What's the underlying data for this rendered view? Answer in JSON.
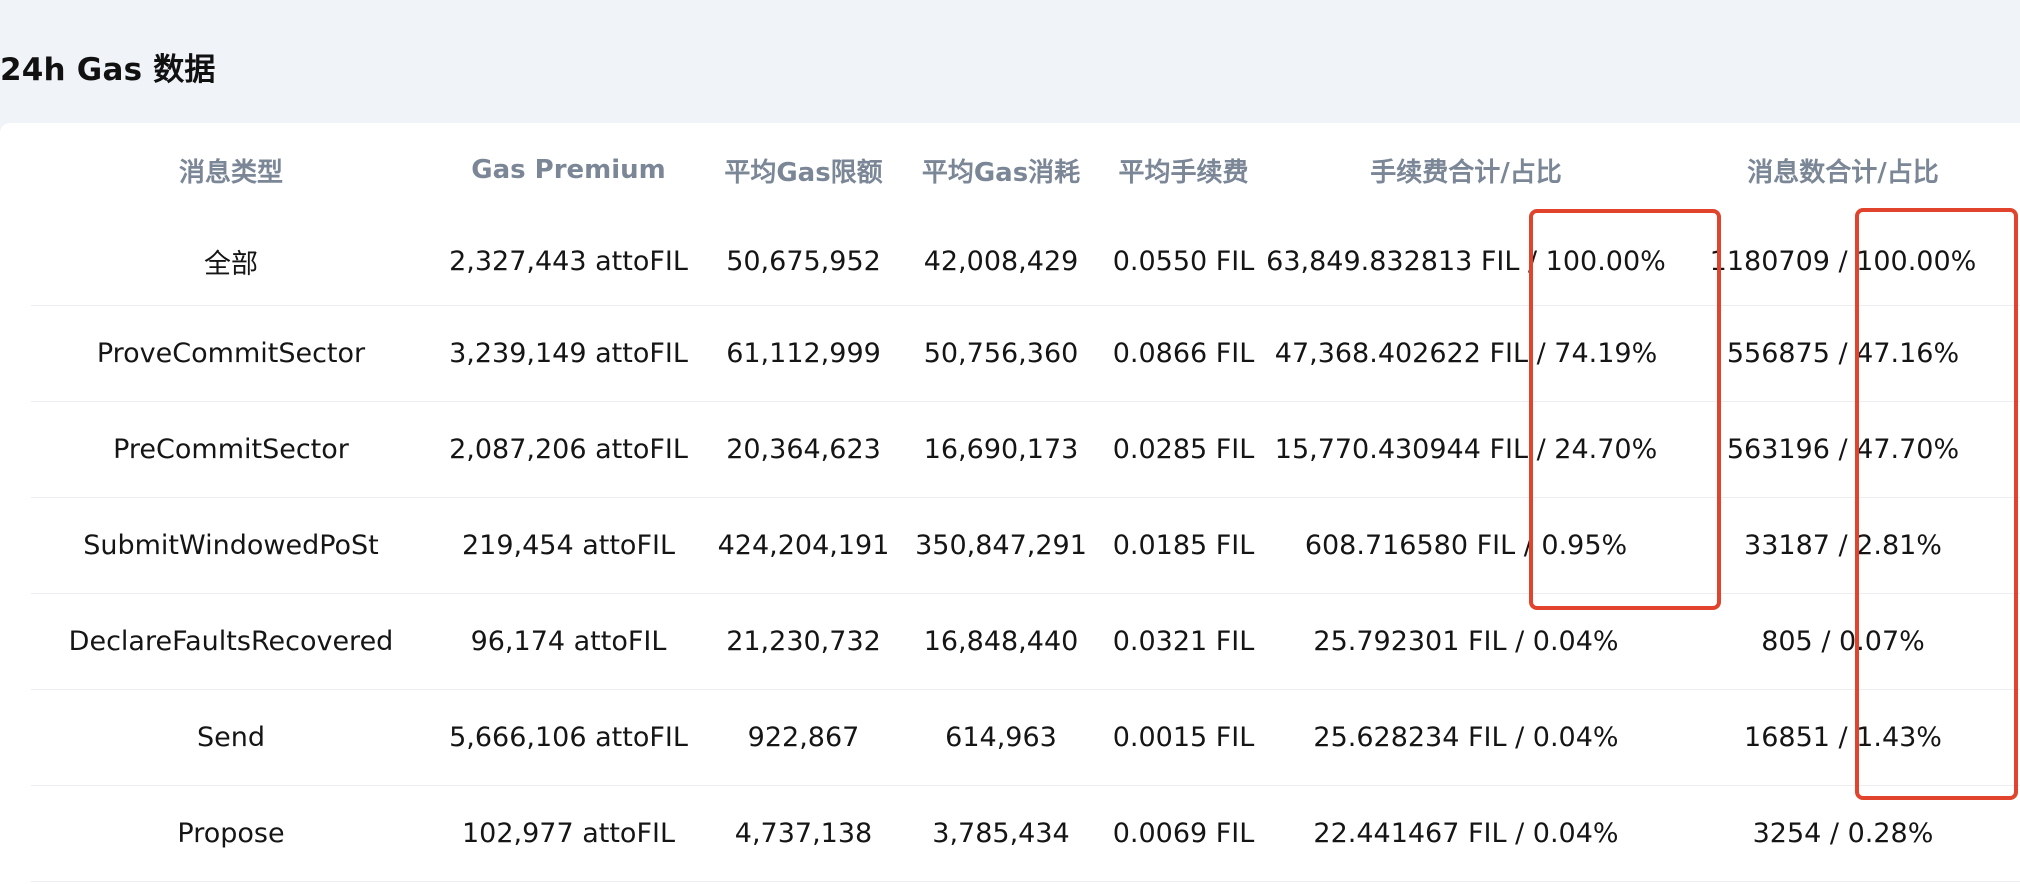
{
  "page": {
    "title": "24h Gas 数据"
  },
  "table": {
    "headers": [
      "消息类型",
      "Gas Premium",
      "平均Gas限额",
      "平均Gas消耗",
      "平均手续费",
      "手续费合计/占比",
      "消息数合计/占比"
    ],
    "rows": [
      [
        "全部",
        "2,327,443 attoFIL",
        "50,675,952",
        "42,008,429",
        "0.0550 FIL",
        "63,849.832813 FIL / 100.00%",
        "1180709 / 100.00%"
      ],
      [
        "ProveCommitSector",
        "3,239,149 attoFIL",
        "61,112,999",
        "50,756,360",
        "0.0866 FIL",
        "47,368.402622 FIL / 74.19%",
        "556875 / 47.16%"
      ],
      [
        "PreCommitSector",
        "2,087,206 attoFIL",
        "20,364,623",
        "16,690,173",
        "0.0285 FIL",
        "15,770.430944 FIL / 24.70%",
        "563196 / 47.70%"
      ],
      [
        "SubmitWindowedPoSt",
        "219,454 attoFIL",
        "424,204,191",
        "350,847,291",
        "0.0185 FIL",
        "608.716580 FIL / 0.95%",
        "33187 / 2.81%"
      ],
      [
        "DeclareFaultsRecovered",
        "96,174 attoFIL",
        "21,230,732",
        "16,848,440",
        "0.0321 FIL",
        "25.792301 FIL / 0.04%",
        "805 / 0.07%"
      ],
      [
        "Send",
        "5,666,106 attoFIL",
        "922,867",
        "614,963",
        "0.0015 FIL",
        "25.628234 FIL / 0.04%",
        "16851 / 1.43%"
      ],
      [
        "Propose",
        "102,977 attoFIL",
        "4,737,138",
        "3,785,434",
        "0.0069 FIL",
        "22.441467 FIL / 0.04%",
        "3254 / 0.28%"
      ]
    ]
  },
  "annotations": {
    "color": "#e2432d"
  }
}
